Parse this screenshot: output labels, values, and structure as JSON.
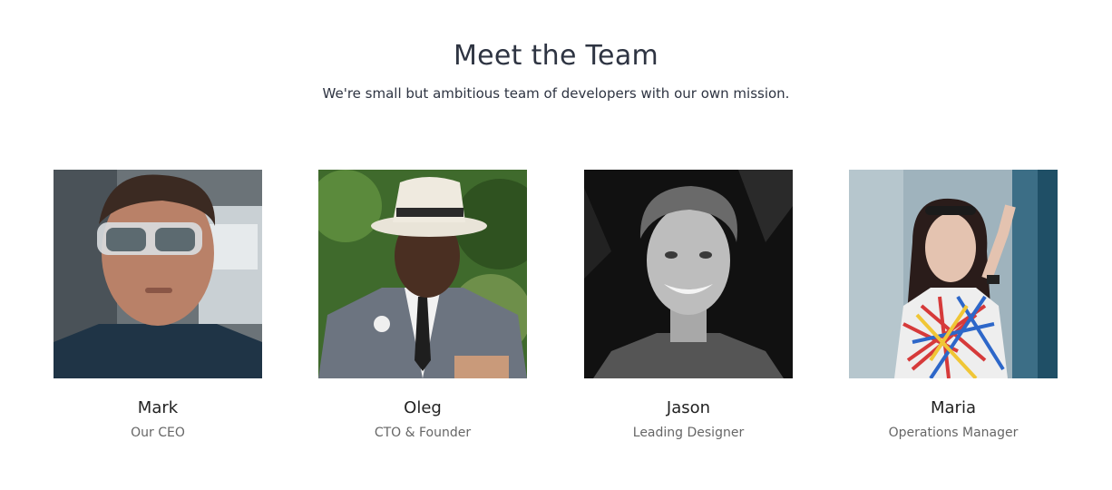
{
  "section": {
    "title": "Meet the Team",
    "subtitle": "We're small but ambitious team of developers with our own mission."
  },
  "team": [
    {
      "name": "Mark",
      "role": "Our CEO"
    },
    {
      "name": "Oleg",
      "role": "CTO & Founder"
    },
    {
      "name": "Jason",
      "role": "Leading Designer"
    },
    {
      "name": "Maria",
      "role": "Operations Manager"
    }
  ],
  "colors": {
    "heading": "#2e3442",
    "name": "#222222",
    "role": "#666666",
    "background": "#ffffff"
  }
}
